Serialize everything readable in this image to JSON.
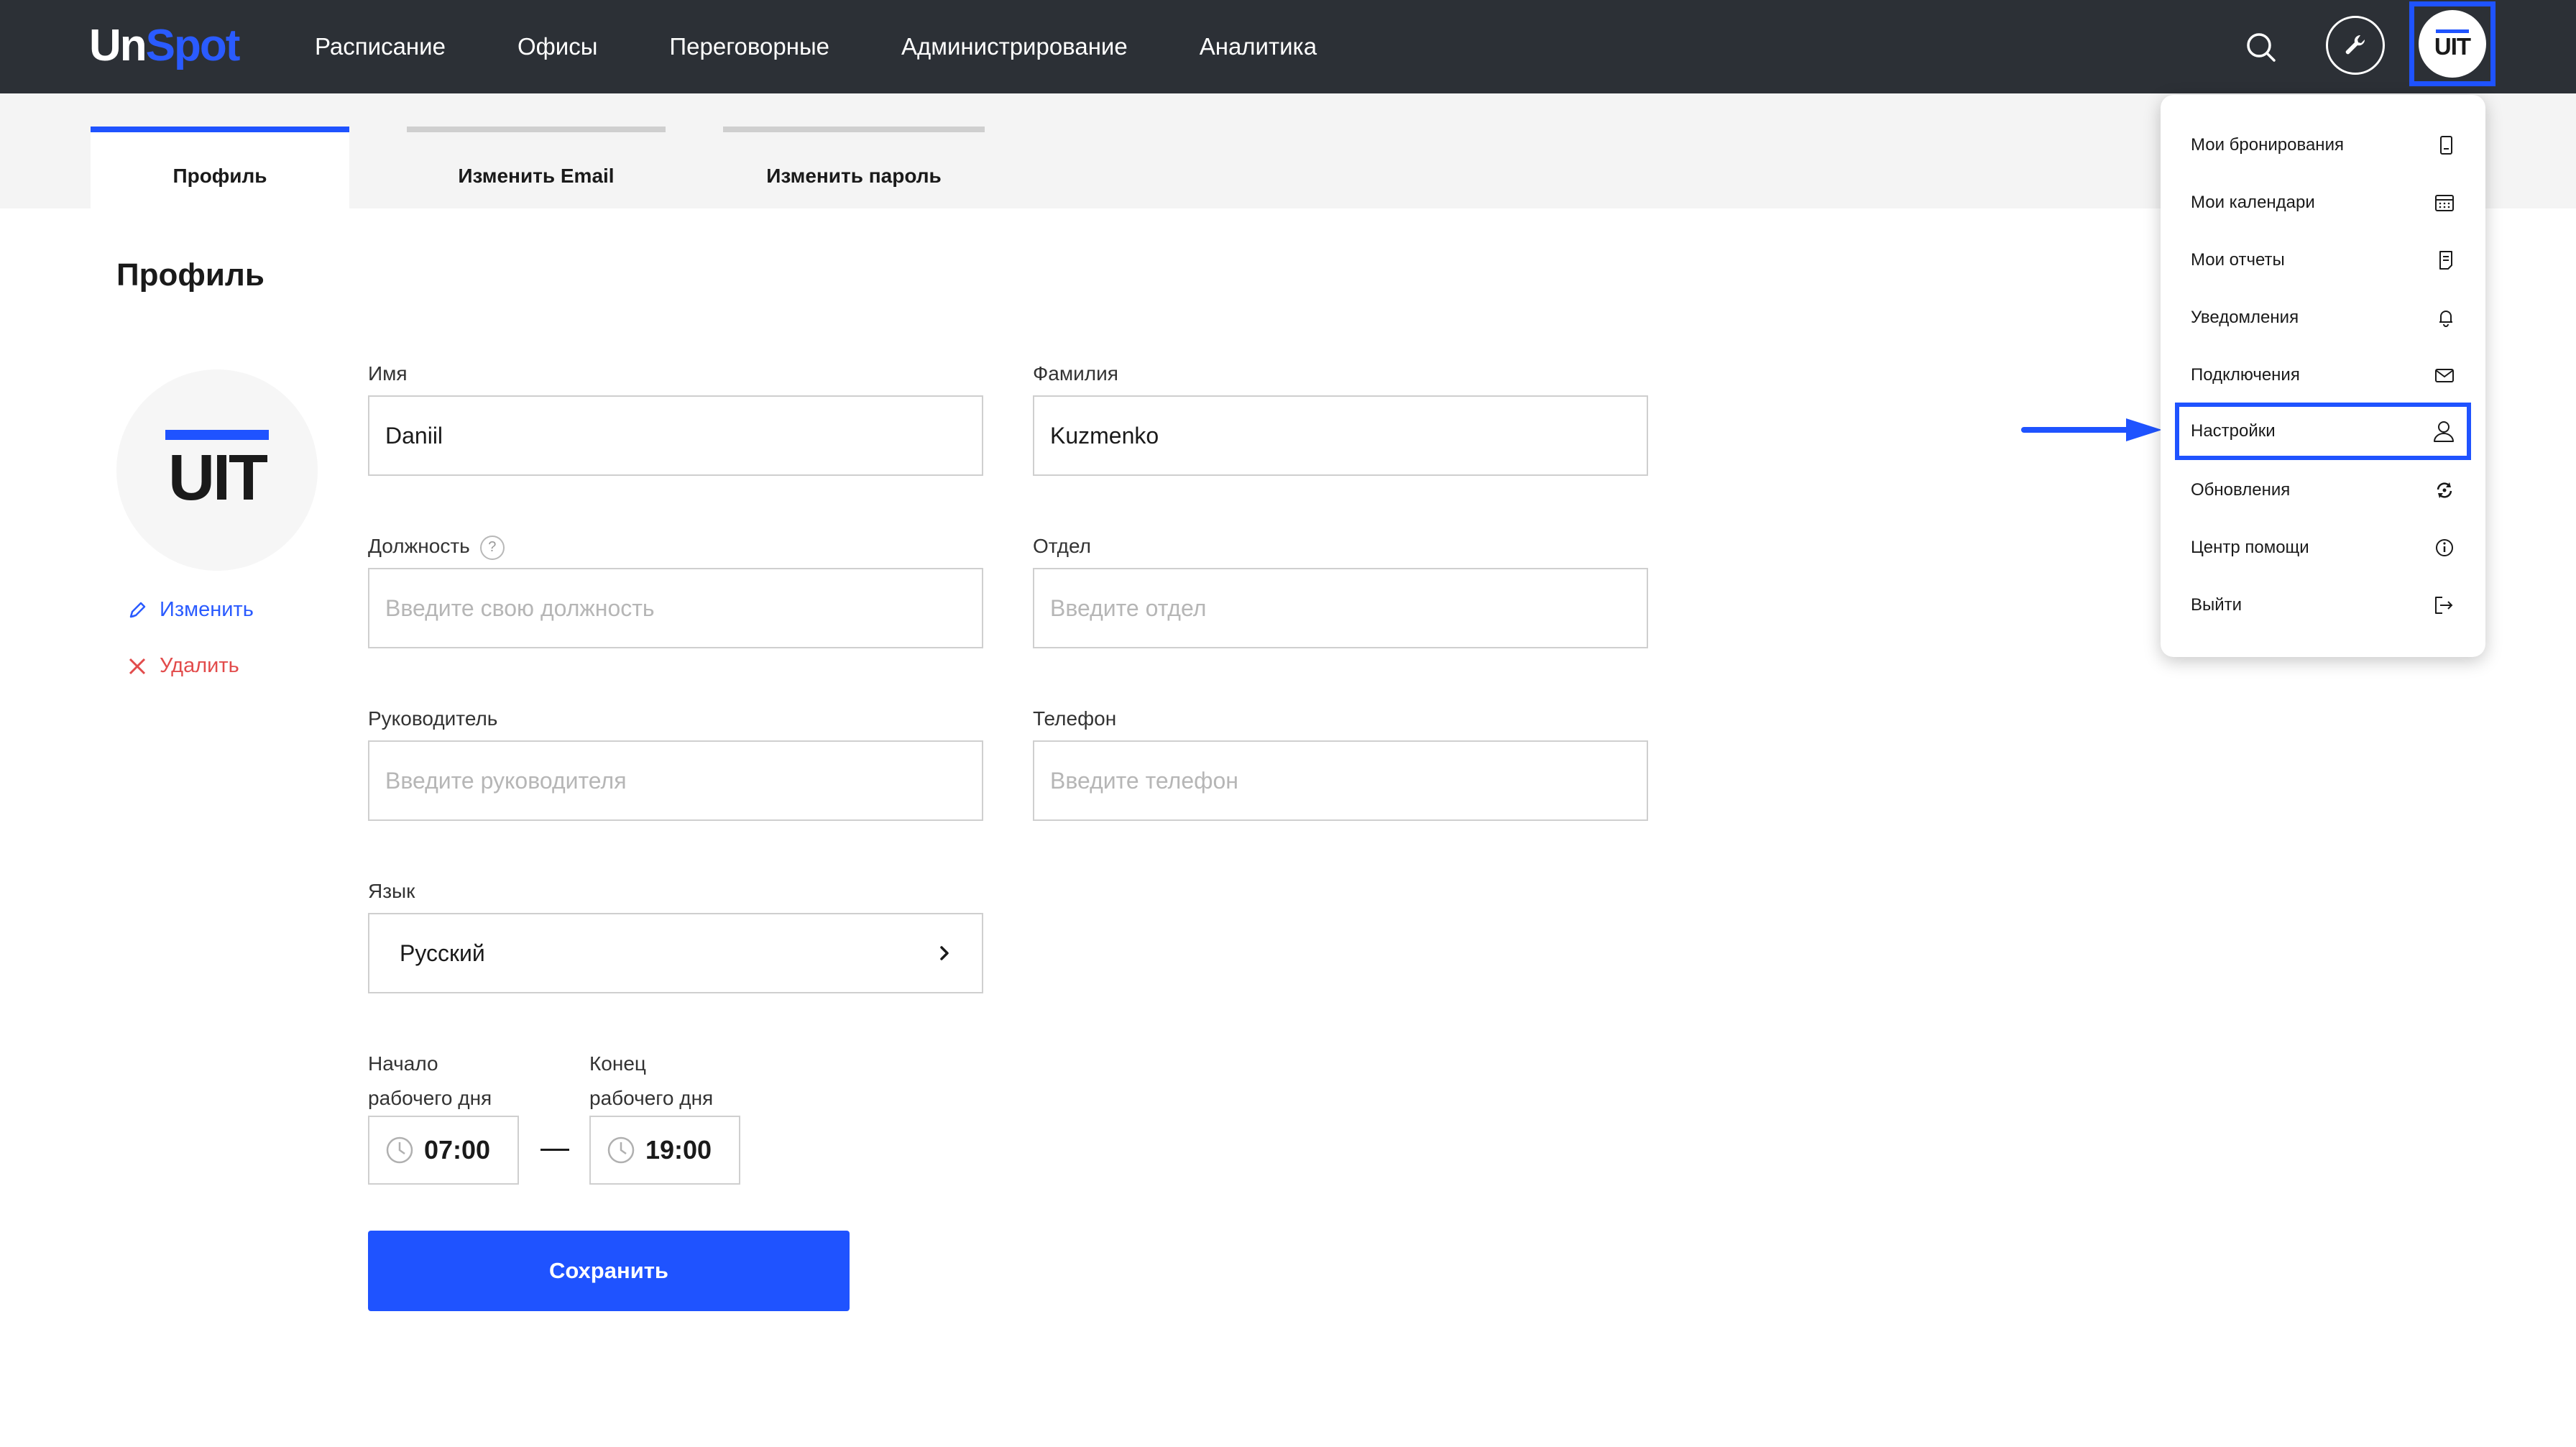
{
  "header": {
    "logo_part1": "Un",
    "logo_part2": "Spot",
    "nav": [
      "Расписание",
      "Офисы",
      "Переговорные",
      "Администрирование",
      "Аналитика"
    ],
    "avatar_text": "UIT"
  },
  "tabs": [
    "Профиль",
    "Изменить Email",
    "Изменить пароль"
  ],
  "page_title": "Профиль",
  "profile": {
    "avatar_text": "UIT",
    "edit_label": "Изменить",
    "delete_label": "Удалить"
  },
  "form": {
    "first_name": {
      "label": "Имя",
      "value": "Daniil"
    },
    "last_name": {
      "label": "Фамилия",
      "value": "Kuzmenko"
    },
    "position": {
      "label": "Должность",
      "placeholder": "Введите свою должность",
      "help": "?"
    },
    "department": {
      "label": "Отдел",
      "placeholder": "Введите отдел"
    },
    "manager": {
      "label": "Руководитель",
      "placeholder": "Введите руководителя"
    },
    "phone": {
      "label": "Телефон",
      "placeholder": "Введите телефон"
    },
    "language": {
      "label": "Язык",
      "value": "Русский"
    },
    "work_start": {
      "label_line1": "Начало",
      "label_line2": "рабочего дня",
      "value": "07:00"
    },
    "work_end": {
      "label_line1": "Конец",
      "label_line2": "рабочего дня",
      "value": "19:00"
    },
    "save_label": "Сохранить"
  },
  "menu": {
    "items": [
      {
        "label": "Мои бронирования",
        "icon": "booking-icon"
      },
      {
        "label": "Мои календари",
        "icon": "calendar-icon"
      },
      {
        "label": "Мои отчеты",
        "icon": "report-icon"
      },
      {
        "label": "Уведомления",
        "icon": "bell-icon"
      },
      {
        "label": "Подключения",
        "icon": "mail-icon"
      },
      {
        "label": "Настройки",
        "icon": "user-icon"
      },
      {
        "label": "Обновления",
        "icon": "refresh-icon"
      },
      {
        "label": "Центр помощи",
        "icon": "info-icon"
      },
      {
        "label": "Выйти",
        "icon": "logout-icon"
      }
    ],
    "highlighted": "Настройки"
  },
  "colors": {
    "accent": "#1f53ff",
    "topbar": "#2c3036",
    "danger": "#e24b4b"
  }
}
